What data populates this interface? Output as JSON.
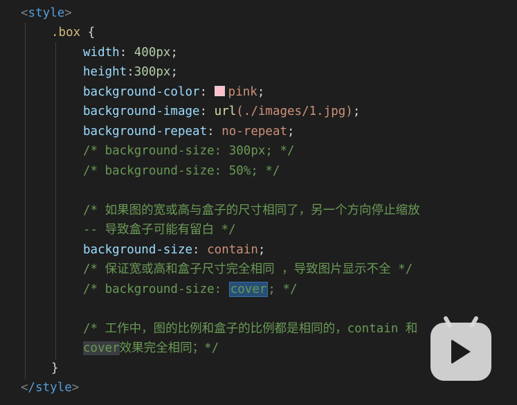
{
  "code": {
    "style_open_tag": "style",
    "style_close_tag": "/style",
    "selector": ".box",
    "open_brace": "{",
    "close_brace": "}",
    "width_prop": "width",
    "width_val": "400px",
    "height_prop": "height",
    "height_val": "300px",
    "bgcolor_prop": "background-color",
    "bgcolor_val": "pink",
    "bgimage_prop": "background-image",
    "bgimage_fn": "url",
    "bgimage_arg": "(./images/1.jpg)",
    "bgrepeat_prop": "background-repeat",
    "bgrepeat_val": "no-repeat",
    "comment1": "/* background-size: 300px; */",
    "comment2": "/* background-size: 50%; */",
    "comment3a": "/* 如果图的宽或高与盒子的尺寸相同了，另一个方向停止缩放",
    "comment3b": "-- 导致盒子可能有留白 */",
    "bgsize_prop": "background-size",
    "bgsize_val": "contain",
    "comment4": "/* 保证宽或高和盒子尺寸完全相同 ，导致图片显示不全 */",
    "comment5_pre": "/* background-size: ",
    "comment5_hl": "cover",
    "comment5_post": "; */",
    "comment6a": "/* 工作中，图的比例和盒子的比例都是相同的，contain 和",
    "comment6b_hl": "cover",
    "comment6b_post": "效果完全相同；*/"
  },
  "overlay": {
    "icon": "play-icon"
  },
  "colors": {
    "background": "#1e1e1e",
    "keyword": "#569cd6",
    "selector": "#d7ba7d",
    "property": "#9cdcfe",
    "string_value": "#ce9178",
    "number": "#b5cea8",
    "comment": "#6a9955",
    "swatch_pink": "#ffc0cb"
  }
}
